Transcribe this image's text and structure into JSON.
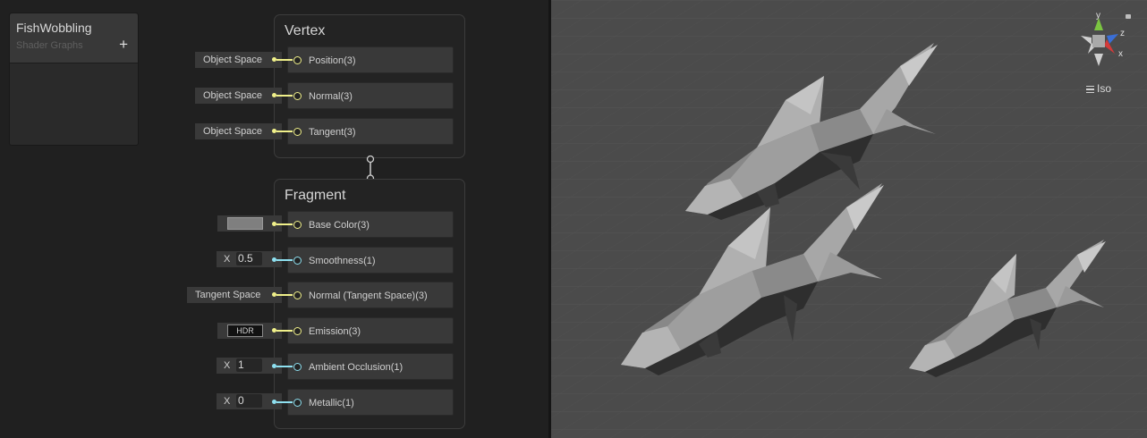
{
  "blackboard": {
    "title": "FishWobbling",
    "subtitle": "Shader Graphs",
    "add_glyph": "+"
  },
  "vertex": {
    "title": "Vertex",
    "blocks": [
      {
        "label": "Position(3)",
        "input": "Object Space"
      },
      {
        "label": "Normal(3)",
        "input": "Object Space"
      },
      {
        "label": "Tangent(3)",
        "input": "Object Space"
      }
    ]
  },
  "fragment": {
    "title": "Fragment",
    "blocks": [
      {
        "label": "Base Color(3)",
        "input_type": "color-swatch",
        "value": "#7f7f7f"
      },
      {
        "label": "Smoothness(1)",
        "input_type": "float",
        "axis": "X",
        "value": "0.5"
      },
      {
        "label": "Normal (Tangent Space)(3)",
        "input": "Tangent Space"
      },
      {
        "label": "Emission(3)",
        "input_type": "hdr-color",
        "value": "HDR"
      },
      {
        "label": "Ambient Occlusion(1)",
        "input_type": "float",
        "axis": "X",
        "value": "1"
      },
      {
        "label": "Metallic(1)",
        "input_type": "float",
        "axis": "X",
        "value": "0"
      }
    ]
  },
  "viewport": {
    "projection": "Iso",
    "gizmo_axes": {
      "y": "y",
      "z": "z",
      "x": "x"
    },
    "colors": {
      "background": "#4b4b4b",
      "grid": "#555555",
      "fish": "#9a9a9a"
    }
  },
  "colors": {
    "vector3_port": "#f0f08a",
    "vector1_port": "#8ee0f0",
    "gizmo_x": "#d23a3a",
    "gizmo_y": "#7bc441",
    "gizmo_z": "#3a6ed6"
  }
}
